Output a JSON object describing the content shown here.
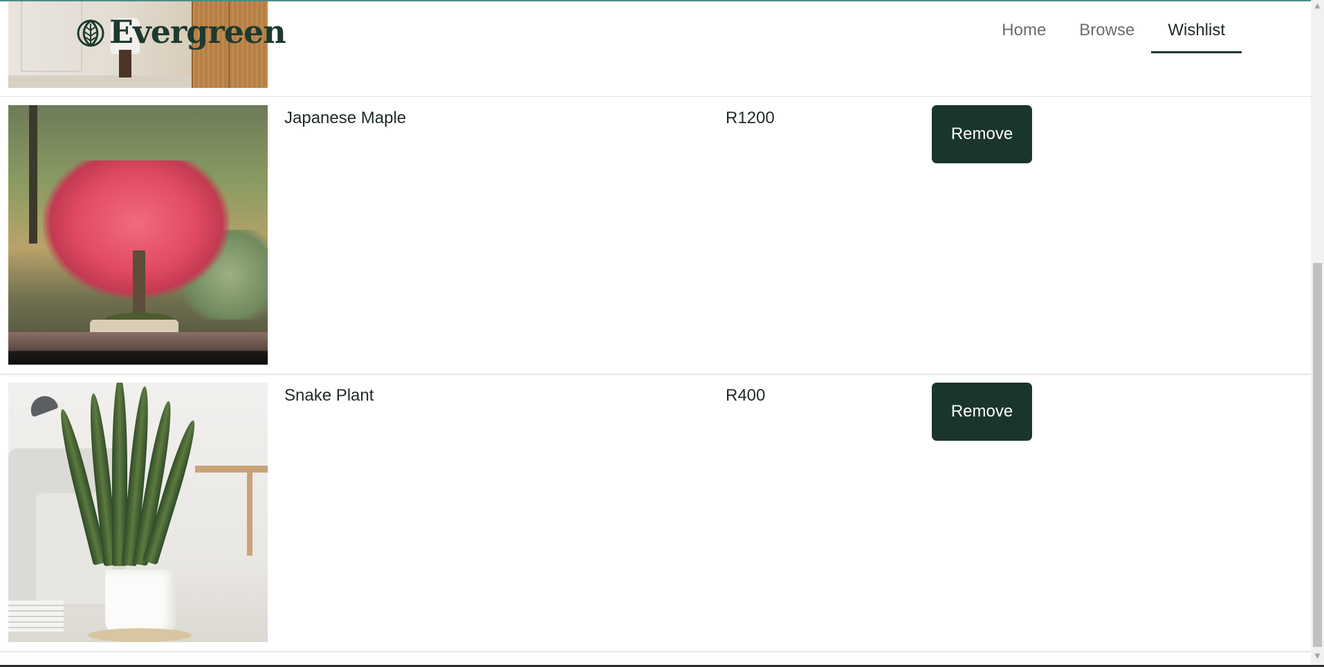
{
  "brand": {
    "name": "Evergreen",
    "icon": "leaf-icon"
  },
  "nav": {
    "items": [
      {
        "label": "Home",
        "active": false
      },
      {
        "label": "Browse",
        "active": false
      },
      {
        "label": "Wishlist",
        "active": true
      }
    ]
  },
  "wishlist": {
    "items": [
      {
        "name": "Japanese Maple",
        "price": "R1200",
        "action_label": "Remove",
        "image": "japanese-maple-bonsai-photo"
      },
      {
        "name": "Snake Plant",
        "price": "R400",
        "action_label": "Remove",
        "image": "snake-plant-in-white-pot-photo"
      }
    ]
  },
  "colors": {
    "brand_dark_green": "#1a352c",
    "active_nav_underline": "#1d3a2e",
    "nav_inactive_text": "#6c6c6c",
    "top_accent": "#4d8c86"
  }
}
